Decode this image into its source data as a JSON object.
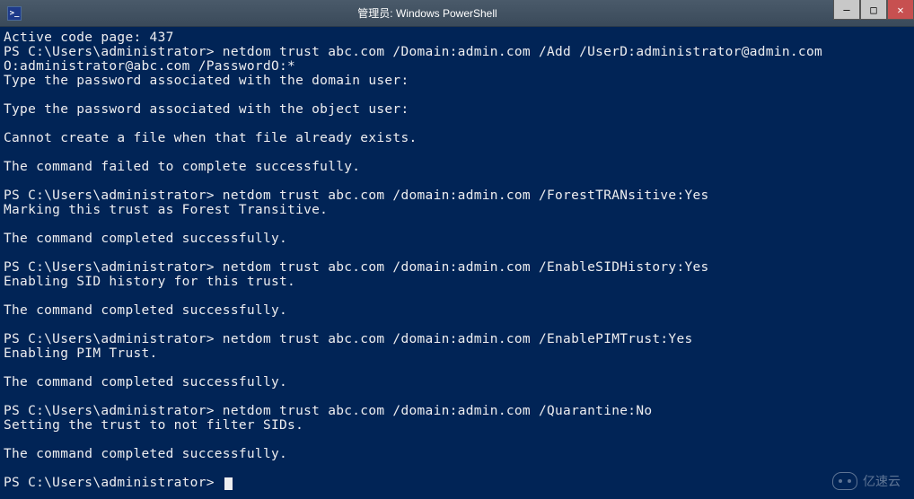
{
  "window": {
    "icon_glyph": ">_",
    "title": "管理员: Windows PowerShell",
    "min_symbol": "—",
    "max_symbol": "□",
    "close_symbol": "✕"
  },
  "terminal_lines": [
    "Active code page: 437",
    "PS C:\\Users\\administrator> netdom trust abc.com /Domain:admin.com /Add /UserD:administrator@admin.com",
    "O:administrator@abc.com /PasswordO:*",
    "Type the password associated with the domain user:",
    "",
    "Type the password associated with the object user:",
    "",
    "Cannot create a file when that file already exists.",
    "",
    "The command failed to complete successfully.",
    "",
    "PS C:\\Users\\administrator> netdom trust abc.com /domain:admin.com /ForestTRANsitive:Yes",
    "Marking this trust as Forest Transitive.",
    "",
    "The command completed successfully.",
    "",
    "PS C:\\Users\\administrator> netdom trust abc.com /domain:admin.com /EnableSIDHistory:Yes",
    "Enabling SID history for this trust.",
    "",
    "The command completed successfully.",
    "",
    "PS C:\\Users\\administrator> netdom trust abc.com /domain:admin.com /EnablePIMTrust:Yes",
    "Enabling PIM Trust.",
    "",
    "The command completed successfully.",
    "",
    "PS C:\\Users\\administrator> netdom trust abc.com /domain:admin.com /Quarantine:No",
    "Setting the trust to not filter SIDs.",
    "",
    "The command completed successfully.",
    "",
    "PS C:\\Users\\administrator> "
  ],
  "watermark": {
    "text": "亿速云"
  }
}
